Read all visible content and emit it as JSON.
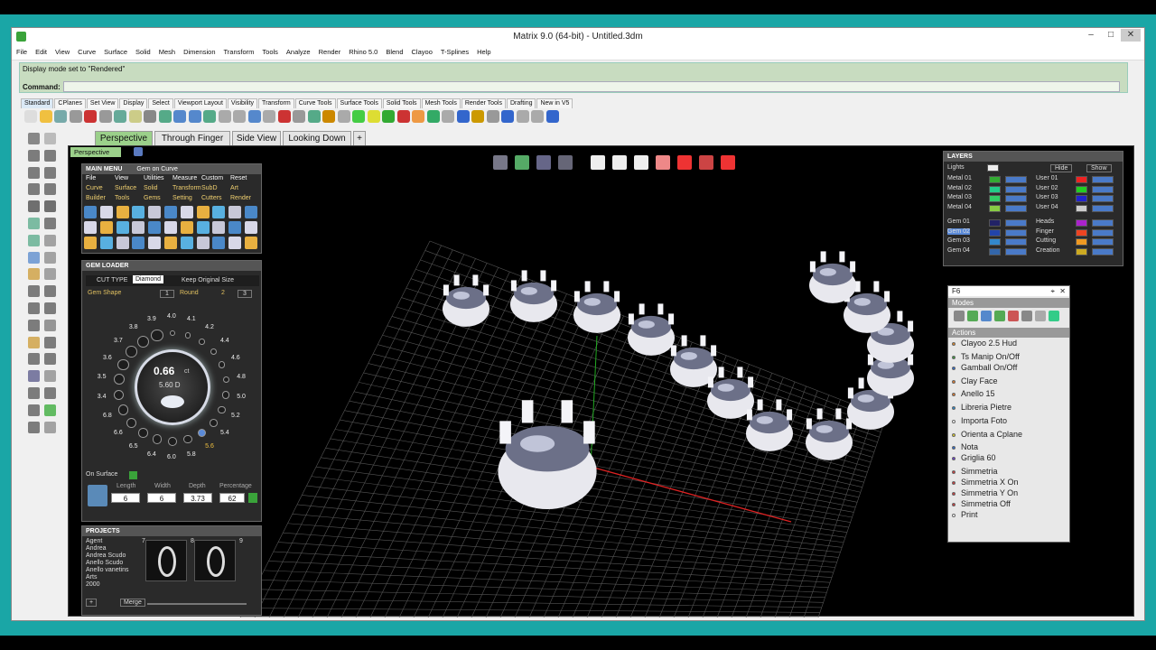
{
  "window": {
    "title": "Matrix 9.0 (64-bit) - Untitled.3dm"
  },
  "menu": [
    "File",
    "Edit",
    "View",
    "Curve",
    "Surface",
    "Solid",
    "Mesh",
    "Dimension",
    "Transform",
    "Tools",
    "Analyze",
    "Render",
    "Rhino 5.0",
    "Blend",
    "Clayoo",
    "T-Splines",
    "Help"
  ],
  "command": {
    "message": "Display mode set to \"Rendered\"",
    "label": "Command:"
  },
  "toolbar_tabs": [
    "Standard",
    "CPlanes",
    "Set View",
    "Display",
    "Select",
    "Viewport Layout",
    "Visibility",
    "Transform",
    "Curve Tools",
    "Surface Tools",
    "Solid Tools",
    "Mesh Tools",
    "Render Tools",
    "Drafting",
    "New in V5"
  ],
  "viewport_tabs": [
    "Perspective",
    "Through Finger",
    "Side View",
    "Looking Down"
  ],
  "viewport_label": "Perspective",
  "main_menu": {
    "title": "MAIN MENU",
    "subtitle": "Gem on Curve",
    "row1": [
      "File",
      "View",
      "Utilities",
      "Measure",
      "Custom",
      "Reset"
    ],
    "row2": [
      "Curve",
      "Surface",
      "Solid",
      "Transform",
      "SubD",
      "Art"
    ],
    "row3": [
      "Builder",
      "Tools",
      "Gems",
      "Setting",
      "Cutters",
      "Render"
    ]
  },
  "gem_loader": {
    "title": "GEM LOADER",
    "cut_type_label": "CUT TYPE",
    "cut_type": "Diamond",
    "keep_size": "Keep Original Size",
    "gem_shape": "Gem Shape",
    "shape_num": "1",
    "shape_name": "Round",
    "n2": "2",
    "n3": "3",
    "carat": "0.66",
    "carat_unit": "ct",
    "diameter": "5.60 D",
    "sizes": [
      "4.0",
      "4.1",
      "4.2",
      "4.4",
      "4.6",
      "4.8",
      "5.0",
      "5.2",
      "5.4",
      "5.6",
      "5.8",
      "6.0",
      "6.4",
      "6.5",
      "6.6",
      "6.8",
      "3.4",
      "3.5",
      "3.6",
      "3.7",
      "3.8",
      "3.9"
    ],
    "on_surface": "On Surface",
    "headers": [
      "Length",
      "Width",
      "Depth",
      "Percentage"
    ],
    "values": [
      "6",
      "6",
      "3.73",
      "62"
    ]
  },
  "projects": {
    "title": "PROJECTS",
    "list": [
      "Agent",
      "Andrea",
      "Andrea Scudo",
      "Anello Scudo",
      "Anello vanetins",
      "Arts",
      "2000"
    ],
    "thumbs": [
      "7",
      "8",
      "9"
    ],
    "merge": "Merge"
  },
  "layers": {
    "title": "LAYERS",
    "lights": "Lights",
    "hide": "Hide",
    "show": "Show",
    "left": [
      "Metal 01",
      "Metal 02",
      "Metal 03",
      "Metal 04",
      "Gem 01",
      "Gem 02",
      "Gem 03",
      "Gem 04"
    ],
    "right": [
      "User 01",
      "User 02",
      "User 03",
      "User 04",
      "Heads",
      "Finger",
      "Cutting",
      "Creation"
    ]
  },
  "f6": {
    "title": "F6",
    "modes": "Modes",
    "actions": "Actions",
    "items": [
      {
        "label": "Clayoo 2.5 Hud",
        "color": "#e08a2a"
      },
      {
        "label": "Ts Manip On/Off",
        "color": "#3b9a3b"
      },
      {
        "label": "Gamball   On/Off",
        "color": "#2a6bd0"
      },
      {
        "label": "Clay Face",
        "color": "#e07a2a"
      },
      {
        "label": "Anello 15",
        "color": "#e07a2a"
      },
      {
        "label": "Libreria Pietre",
        "color": "#2a8ad0"
      },
      {
        "label": "Importa Foto",
        "color": "#ffffff"
      },
      {
        "label": "Orienta a Cplane",
        "color": "#e0d02a"
      },
      {
        "label": "Nota",
        "color": "#2a6bd0"
      },
      {
        "label": "Griglia 60",
        "color": "#6a3ad0"
      },
      {
        "label": "Simmetria",
        "color": "#d03a3a"
      },
      {
        "label": "Simmetria X On",
        "color": "#d03a3a"
      },
      {
        "label": "Simmetria Y On",
        "color": "#d03a3a"
      },
      {
        "label": "Simmetria Off",
        "color": "#d03a3a"
      },
      {
        "label": "Print",
        "color": "#ffffff"
      }
    ]
  }
}
